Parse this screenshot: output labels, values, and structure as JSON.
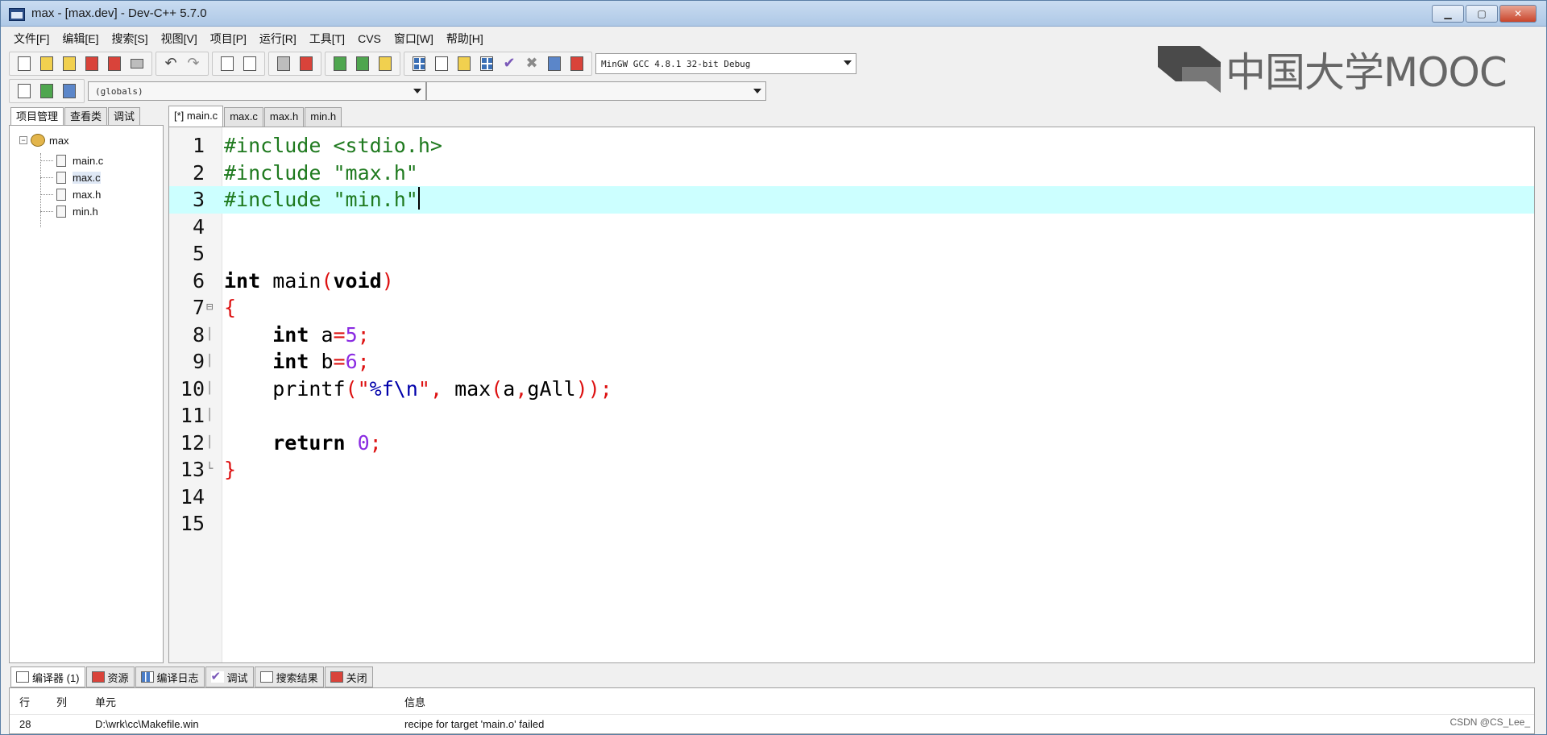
{
  "window": {
    "title": "max - [max.dev] - Dev-C++ 5.7.0"
  },
  "menu": [
    "文件[F]",
    "编辑[E]",
    "搜索[S]",
    "视图[V]",
    "项目[P]",
    "运行[R]",
    "工具[T]",
    "CVS",
    "窗口[W]",
    "帮助[H]"
  ],
  "toolbar": {
    "compiler": "MinGW GCC 4.8.1 32-bit Debug",
    "scope": "(globals)",
    "function": ""
  },
  "logo": {
    "text": "中国大学MOOC"
  },
  "left_tabs": [
    "项目管理",
    "查看类",
    "调试"
  ],
  "project": {
    "name": "max",
    "files": [
      "main.c",
      "max.c",
      "max.h",
      "min.h"
    ],
    "selected": "max.c"
  },
  "editor_tabs": [
    "[*] main.c",
    "max.c",
    "max.h",
    "min.h"
  ],
  "editor": {
    "current_line": 3,
    "lines": [
      {
        "n": "1",
        "code": "#include <stdio.h>"
      },
      {
        "n": "2",
        "code": "#include \"max.h\""
      },
      {
        "n": "3",
        "code": "#include \"min.h\""
      },
      {
        "n": "4",
        "code": ""
      },
      {
        "n": "5",
        "code": ""
      },
      {
        "n": "6",
        "code": "int main(void)"
      },
      {
        "n": "7",
        "code": "{"
      },
      {
        "n": "8",
        "code": "    int a=5;"
      },
      {
        "n": "9",
        "code": "    int b=6;"
      },
      {
        "n": "10",
        "code": "    printf(\"%f\\n\", max(a,gAll));"
      },
      {
        "n": "11",
        "code": ""
      },
      {
        "n": "12",
        "code": "    return 0;"
      },
      {
        "n": "13",
        "code": "}"
      },
      {
        "n": "14",
        "code": ""
      },
      {
        "n": "15",
        "code": ""
      }
    ]
  },
  "bottom_tabs": [
    "编译器 (1)",
    "资源",
    "编译日志",
    "调试",
    "搜索结果",
    "关闭"
  ],
  "messages": {
    "headers": [
      "行",
      "列",
      "单元",
      "信息"
    ],
    "rows": [
      {
        "line": "28",
        "col": "",
        "unit": "D:\\wrk\\cc\\Makefile.win",
        "info": "recipe for target 'main.o' failed"
      }
    ]
  },
  "watermark": "CSDN @CS_Lee_",
  "colors": {
    "current_line": "#ccffff",
    "preprocessor": "#1f7a1f",
    "symbol": "#dd1111",
    "number": "#8a2be2"
  }
}
